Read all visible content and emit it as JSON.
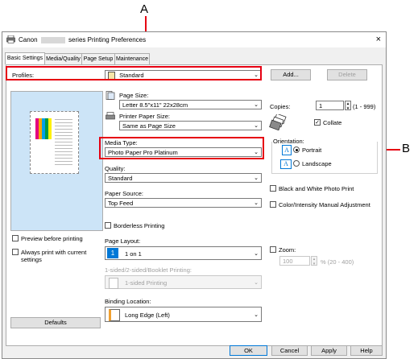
{
  "callouts": {
    "a": "A",
    "b": "B"
  },
  "window": {
    "title_prefix": "Canon",
    "title_suffix": "series Printing Preferences",
    "close": "×"
  },
  "tabs": [
    "Basic Settings",
    "Media/Quality",
    "Page Setup",
    "Maintenance"
  ],
  "profiles": {
    "label": "Profiles:",
    "value": "Standard",
    "add": "Add...",
    "delete": "Delete"
  },
  "page_size": {
    "label": "Page Size:",
    "value": "Letter 8.5\"x11\" 22x28cm"
  },
  "printer_paper_size": {
    "label": "Printer Paper Size:",
    "value": "Same as Page Size"
  },
  "media_type": {
    "label": "Media Type:",
    "value": "Photo Paper Pro Platinum"
  },
  "quality": {
    "label": "Quality:",
    "value": "Standard"
  },
  "paper_source": {
    "label": "Paper Source:",
    "value": "Top Feed"
  },
  "borderless": {
    "label": "Borderless Printing",
    "checked": false
  },
  "page_layout": {
    "label": "Page Layout:",
    "value": "1 on 1",
    "icon_text": "1"
  },
  "duplex": {
    "label": "1-sided/2-sided/Booklet Printing:",
    "value": "1-sided Printing"
  },
  "binding": {
    "label": "Binding Location:",
    "value": "Long Edge (Left)"
  },
  "copies": {
    "label": "Copies:",
    "value": "1",
    "range": "(1 - 999)"
  },
  "collate": {
    "label": "Collate",
    "checked": true
  },
  "orientation": {
    "label": "Orientation:",
    "portrait": "Portrait",
    "landscape": "Landscape",
    "selected": "Portrait",
    "icon_letter": "A"
  },
  "bw_photo": {
    "label": "Black and White Photo Print",
    "checked": false
  },
  "color_manual": {
    "label": "Color/Intensity Manual Adjustment",
    "checked": false
  },
  "zoom": {
    "label": "Zoom:",
    "value": "100",
    "range": "% (20 - 400)",
    "checked": false
  },
  "preview": {
    "label": "Preview before printing",
    "checked": false
  },
  "always_print": {
    "label_line1": "Always print with current",
    "label_line2": "settings",
    "checked": false
  },
  "buttons": {
    "defaults": "Defaults",
    "ok": "OK",
    "cancel": "Cancel",
    "apply": "Apply",
    "help": "Help"
  },
  "colors": {
    "callout_red": "#e60012",
    "preview_bg": "#cce4f7",
    "accent": "#0078d7"
  }
}
